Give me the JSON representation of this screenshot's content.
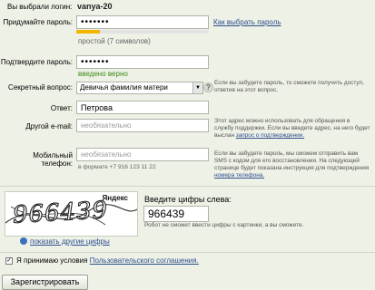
{
  "login": {
    "label": "Вы выбрали логин:",
    "value": "vanya-20"
  },
  "password": {
    "label": "Придумайте пароль:",
    "value": "•••••••",
    "help_link": "Как выбрать пароль",
    "strength": 0.18,
    "strength_text": "простой (7 символов)",
    "colors": {
      "strength": "#f2b600",
      "strength_track": "#e2e2e2"
    }
  },
  "confirm": {
    "label": "Подтвердите пароль:",
    "value": "•••••••",
    "status": "введено верно",
    "status_color": "#3a8a16"
  },
  "secret_question": {
    "label": "Секретный вопрос:",
    "value": "Девичья фамилия матери",
    "help": "Если вы забудете пароль, то сможете получить доступ, ответив на этот вопрос."
  },
  "answer": {
    "label": "Ответ:",
    "value": "Петрова"
  },
  "other_email": {
    "label": "Другой e-mail:",
    "placeholder": "необязательно",
    "help": "Этот адрес можно использовать для обращения в службу поддержки. Если вы введете адрес, на него будет выслан",
    "help_link": "запрос о подтверждении."
  },
  "mobile": {
    "label": "Мобильный телефон:",
    "placeholder": "необязательно",
    "format": "в формате +7 916 123 11 22",
    "help": "Если вы забудете пароль, мы сможем отправить вам SMS с кодом для его восстановления. На следующей странице будет показана инструкция для подтверждения",
    "help_link": "номера телефона."
  },
  "captcha": {
    "image_text": "9664З9",
    "brand": "Яндекс",
    "show_other": "показать другие цифры",
    "prompt": "Введите цифры слева:",
    "value": "966439",
    "note": "Робот не сможет ввести цифры с картинки, а вы сможете."
  },
  "terms": {
    "checked": true,
    "text": "Я принимаю условия",
    "link": "Пользовательского соглашения."
  },
  "submit_label": "Зарегистрировать"
}
